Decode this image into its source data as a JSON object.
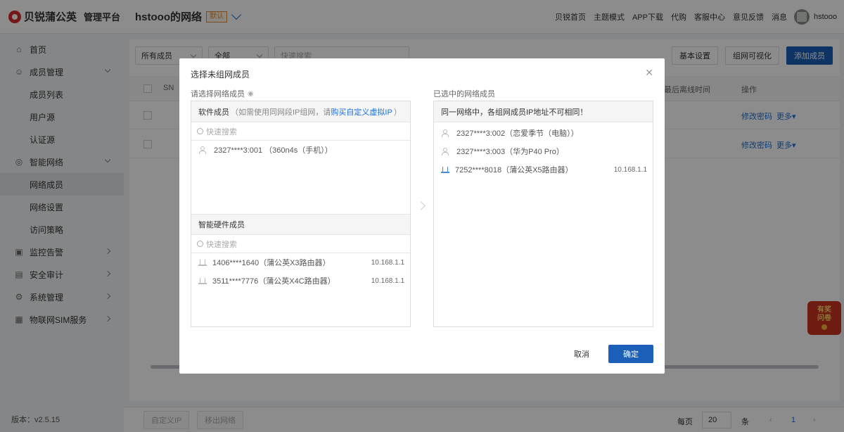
{
  "brand": {
    "name": "贝锐蒲公英",
    "subtitle": "管理平台"
  },
  "network": {
    "name": "hstooo的网络",
    "badge": "默认"
  },
  "topnav": {
    "items": [
      "贝锐首页",
      "主题模式",
      "APP下载",
      "代购",
      "客服中心",
      "意见反馈",
      "消息"
    ],
    "username": "hstooo"
  },
  "sidebar": {
    "items": [
      {
        "label": "首页",
        "icon": "home-icon"
      },
      {
        "label": "成员管理",
        "icon": "user-icon"
      },
      {
        "label": "成员列表"
      },
      {
        "label": "用户源"
      },
      {
        "label": "认证源"
      },
      {
        "label": "智能网络",
        "icon": "network-icon"
      },
      {
        "label": "网络成员"
      },
      {
        "label": "网络设置"
      },
      {
        "label": "访问策略"
      },
      {
        "label": "监控告警",
        "icon": "monitor-icon"
      },
      {
        "label": "安全审计",
        "icon": "audit-icon"
      },
      {
        "label": "系统管理",
        "icon": "settings-icon"
      },
      {
        "label": "物联网SIM服务",
        "icon": "sim-icon"
      }
    ],
    "version": "版本：v2.5.15"
  },
  "main": {
    "filter_member": "所有成员",
    "filter_all": "全部",
    "search_placeholder": "快速搜索",
    "btn_basic": "基本设置",
    "btn_visual": "组网可视化",
    "btn_add": "添加成员",
    "col_sn": "SN",
    "col_last_online": "最后离线时间",
    "col_action": "操作",
    "row_action_pwd": "修改密码",
    "row_action_more": "更多"
  },
  "pager": {
    "btn_custom_ip": "自定义IP",
    "btn_remove": "移出网络",
    "per_page": "每页",
    "size": "20",
    "unit": "条",
    "page": "1"
  },
  "dialog": {
    "title": "选择未组网成员",
    "left_label": "请选择网络成员",
    "software_head": "软件成员",
    "software_note": "（如需使用同网段IP组网，请",
    "software_link": "购买自定义虚拟IP",
    "software_note_end": "）",
    "search_placeholder": "快速搜索",
    "software_members": [
      {
        "name": "2327****3:001 （360n4s（手机））"
      }
    ],
    "hardware_head": "智能硬件成员",
    "hardware_members": [
      {
        "name": "1406****1640（蒲公英X3路由器）",
        "ip": "10.168.1.1"
      },
      {
        "name": "3511****7776（蒲公英X4C路由器）",
        "ip": "10.168.1.1"
      }
    ],
    "right_label": "已选中的网络成员",
    "right_head": "同一网络中，各组网成员IP地址不可相同！",
    "selected_members": [
      {
        "name": "2327****3:002（恋爱季节（电脑））",
        "ip": "",
        "type": "user"
      },
      {
        "name": "2327****3:003（华为P40 Pro）",
        "ip": "",
        "type": "user"
      },
      {
        "name": "7252****8018（蒲公英X5路由器）",
        "ip": "10.168.1.1",
        "type": "router"
      }
    ],
    "cancel": "取消",
    "ok": "确定"
  },
  "promo": {
    "line1": "有奖",
    "line2": "问卷"
  },
  "colors": {
    "primary": "#1b5fb8",
    "brand_red": "#d9292a",
    "link": "#1d6fd6"
  }
}
